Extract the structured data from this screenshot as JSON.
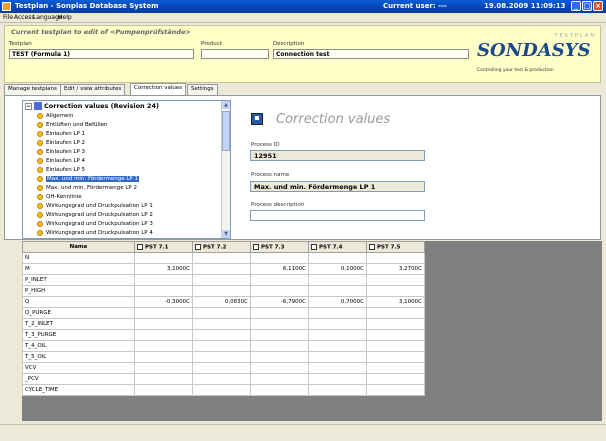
{
  "window": {
    "title": "Testplan - Sonplas Database System",
    "current_user_label": "Current user: ---",
    "datetime": "19.08.2009 11:09:13"
  },
  "menu": [
    "File",
    "Access",
    "Language",
    "Help"
  ],
  "header": {
    "title": "Current testplan to edit of <Pumpenprüfstände>",
    "testplan_label": "Testplan",
    "testplan_value": "TEST (Formula 1)",
    "product_label": "Product",
    "product_value": "",
    "description_label": "Description",
    "description_value": "Connection test",
    "logo_top": "TESTPLAN",
    "logo_brand": "SONDASYS",
    "logo_tagline": "Controlling your test & production"
  },
  "tabs": [
    "Manage testplans",
    "Edit / view attributes",
    "Correction values",
    "Settings"
  ],
  "tree": {
    "root": "Correction values (Revision 24)",
    "items": [
      "Allgemein",
      "Entlüften und Befüllen",
      "Einlaufen LP 1",
      "Einlaufen LP 2",
      "Einlaufen LP 3",
      "Einlaufen LP 4",
      "Einlaufen LP 5",
      "Max. und min. Fördermenge LP 1",
      "Max. und min. Fördermenge LP 2",
      "QH-Kennlinie",
      "Wirkungsgrad und Druckpulsation LP 1",
      "Wirkungsgrad und Druckpulsation LP 2",
      "Wirkungsgrad und Druckpulsation LP 3",
      "Wirkungsgrad und Druckpulsation LP 4"
    ],
    "selected_index": 7
  },
  "process": {
    "heading": "Correction values",
    "id_label": "Process ID",
    "id_value": "12951",
    "name_label": "Process name",
    "name_value": "Max. und min. Fördermenge LP 1",
    "desc_label": "Process description",
    "desc_value": ""
  },
  "grid": {
    "columns": [
      "Name",
      "PST 7.1",
      "PST 7.2",
      "PST 7.3",
      "PST 7.4",
      "PST 7.5"
    ],
    "rows": [
      [
        "N",
        "",
        "",
        "",
        "",
        ""
      ],
      [
        "M",
        "3,1000C",
        "",
        "6,1100C",
        "0,1000C",
        "3,2700C"
      ],
      [
        "P_INLET",
        "",
        "",
        "",
        "",
        ""
      ],
      [
        "P_HIGH",
        "",
        "",
        "",
        "",
        ""
      ],
      [
        "Q",
        "-0,3000C",
        "0,0830C",
        "-6,7900C",
        "0,7000C",
        "3,1000C"
      ],
      [
        "Q_PURGE",
        "",
        "",
        "",
        "",
        ""
      ],
      [
        "T_2_INLET",
        "",
        "",
        "",
        "",
        ""
      ],
      [
        "T_3_PURGE",
        "",
        "",
        "",
        "",
        ""
      ],
      [
        "T_4_OIL",
        "",
        "",
        "",
        "",
        ""
      ],
      [
        "T_5_OIL",
        "",
        "",
        "",
        "",
        ""
      ],
      [
        "VCV",
        "",
        "",
        "",
        "",
        ""
      ],
      [
        "_PCV",
        "",
        "",
        "",
        "",
        ""
      ],
      [
        "CYCLE_TIME",
        "",
        "",
        "",
        "",
        ""
      ]
    ]
  }
}
